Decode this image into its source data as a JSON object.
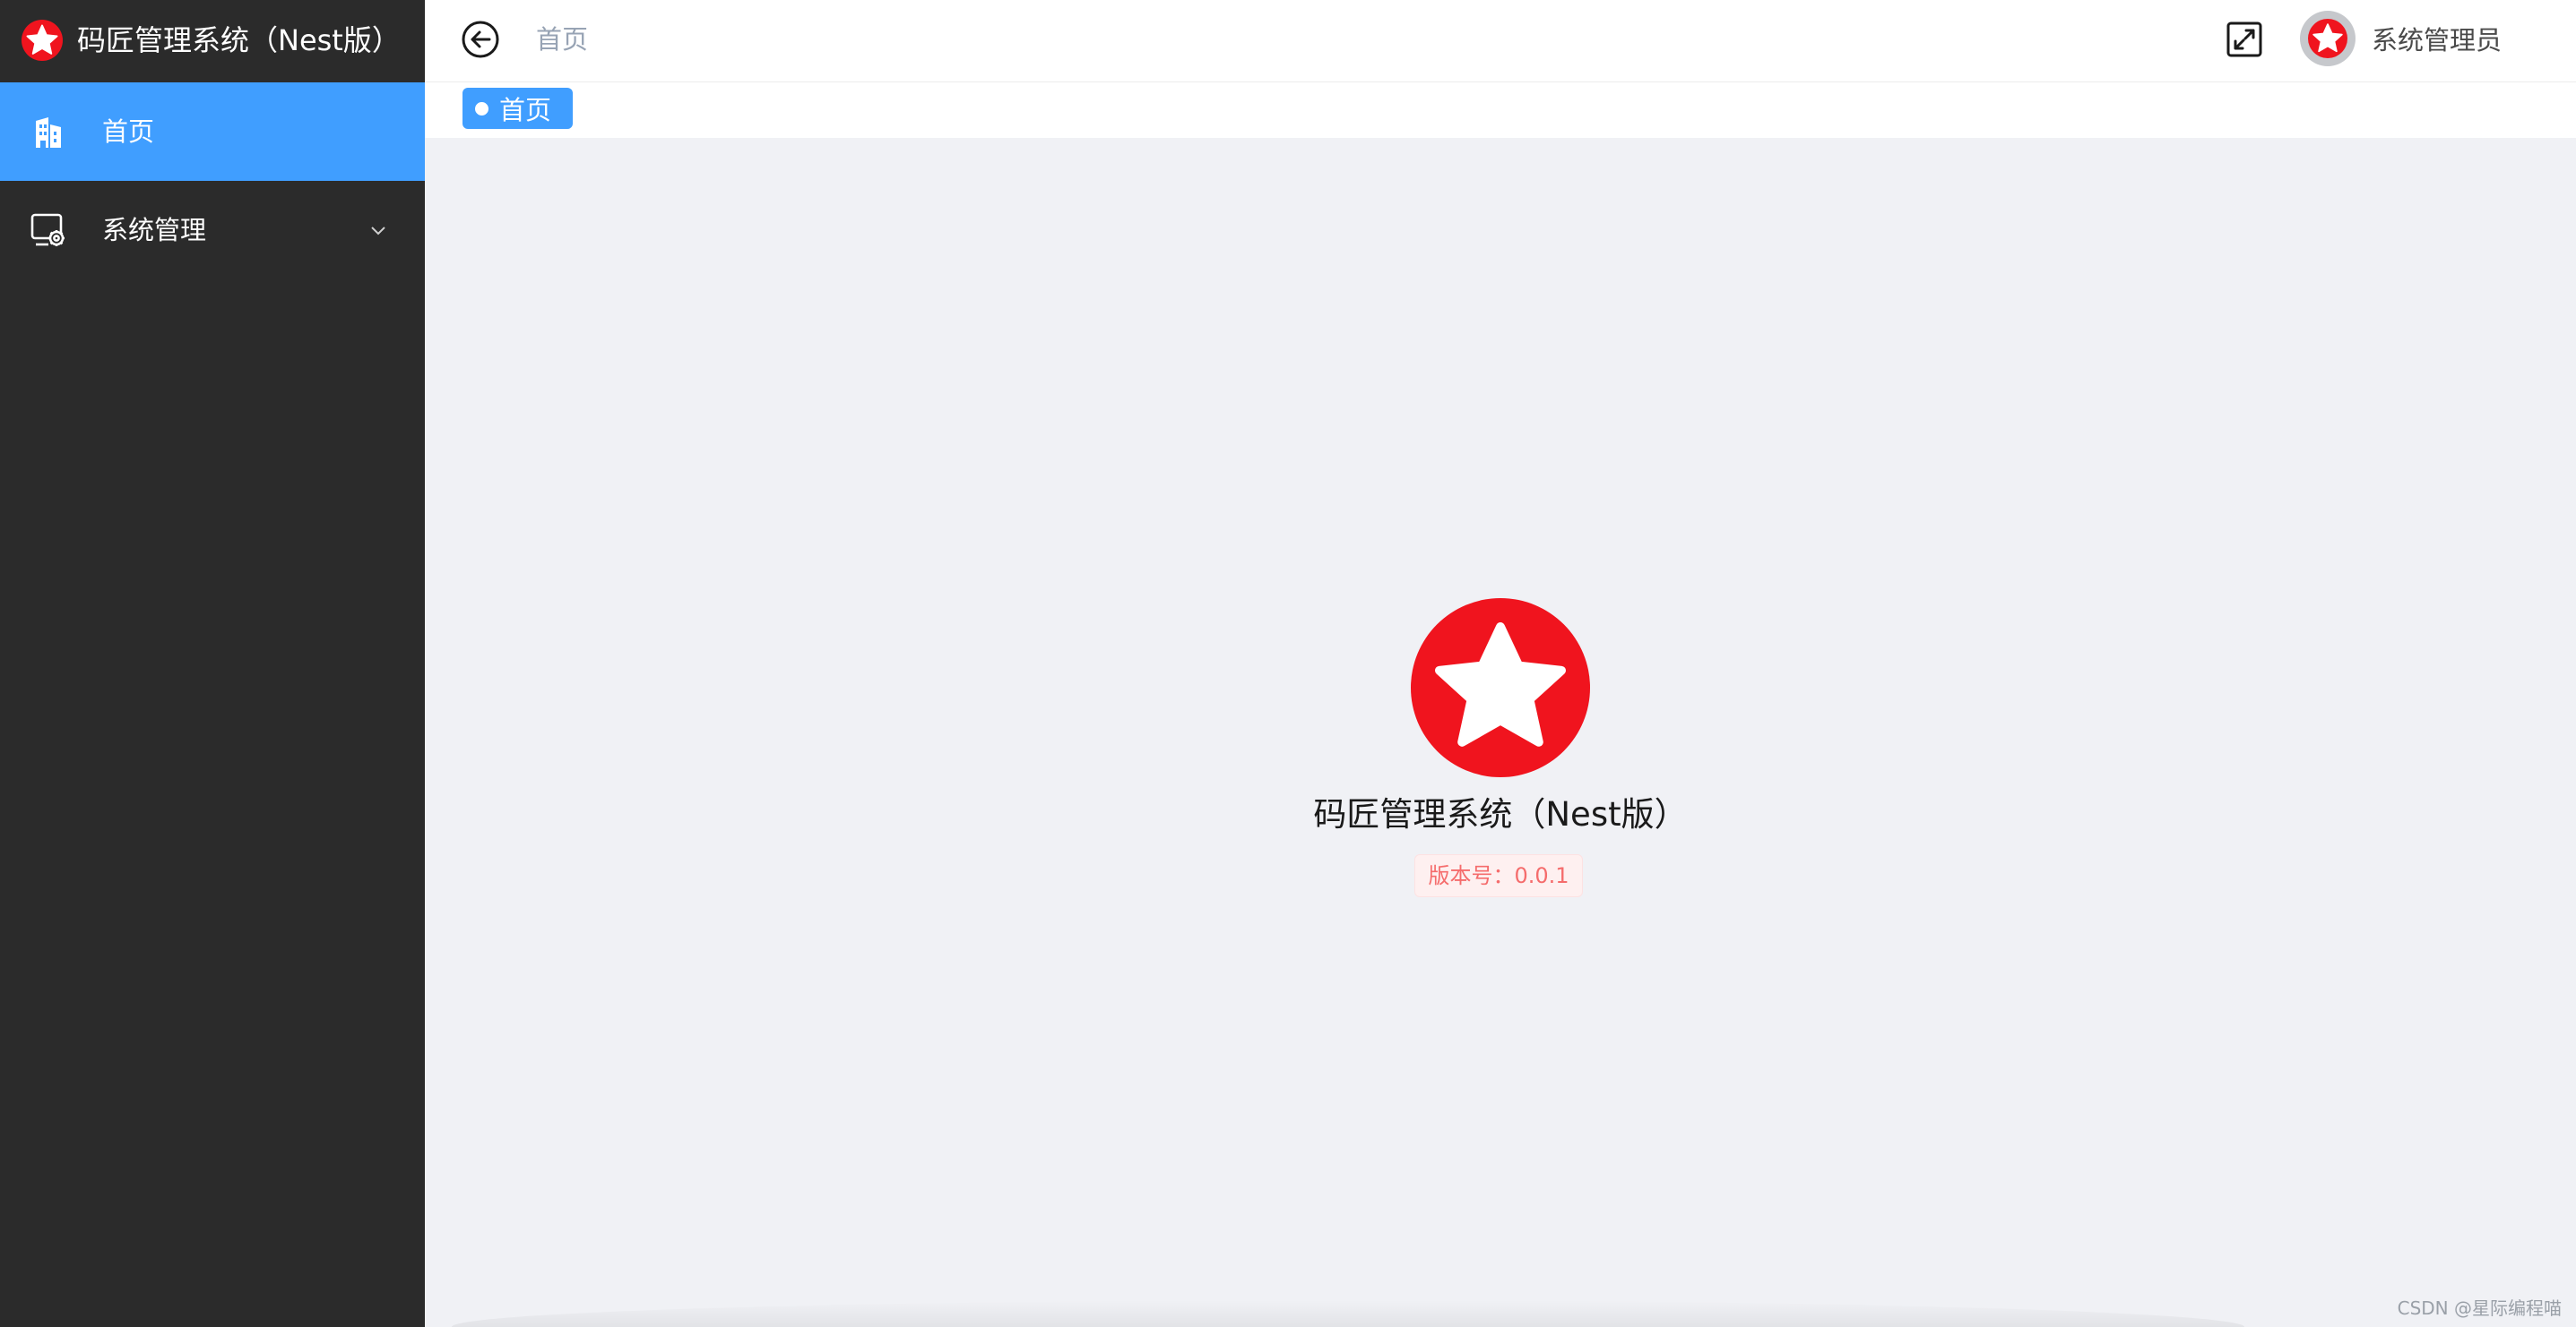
{
  "colors": {
    "sidebar_bg": "#2b2b2b",
    "accent": "#409eff",
    "logo_red": "#f0141e",
    "version_text": "#f56c6c",
    "version_bg": "#fef0f0"
  },
  "sidebar": {
    "brand_title": "码匠管理系统（Nest版）",
    "brand_icon": "star-logo-icon",
    "items": [
      {
        "label": "首页",
        "icon": "building-icon",
        "active": true
      },
      {
        "label": "系统管理",
        "icon": "monitor-settings-icon",
        "active": false,
        "expandable": true
      }
    ]
  },
  "header": {
    "back_icon": "arrow-left-circle-icon",
    "breadcrumb": "首页",
    "fullscreen_icon": "expand-icon",
    "username": "系统管理员"
  },
  "tabs": [
    {
      "label": "首页",
      "active": true
    }
  ],
  "main": {
    "title": "码匠管理系统（Nest版）",
    "version": "版本号：0.0.1"
  },
  "watermark": "CSDN @星际编程喵"
}
